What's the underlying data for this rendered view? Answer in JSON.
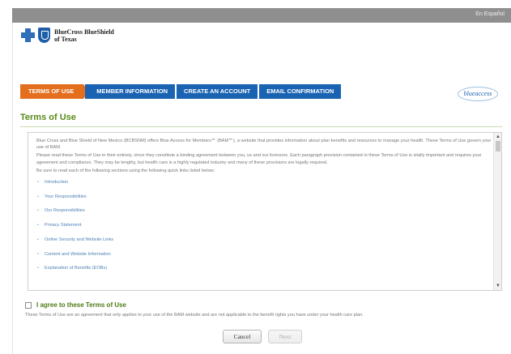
{
  "topbar": {
    "language_link": "En Español"
  },
  "logo": {
    "line1": "BlueCross BlueShield",
    "line2": "of Texas"
  },
  "steps": [
    {
      "label": "TERMS OF USE"
    },
    {
      "label": "MEMBER INFORMATION"
    },
    {
      "label": "CREATE AN ACCOUNT"
    },
    {
      "label": "EMAIL CONFIRMATION"
    }
  ],
  "blue_access_logo": "blueaccess",
  "page_title": "Terms of Use",
  "terms": {
    "paragraphs": [
      "Blue Cross and Blue Shield of New Mexico (BCBSNM) offers Blue Access for Members℠ (BAM℠), a website that provides information about plan benefits and resources to manage your health. These Terms of Use govern your use of BAM.",
      "Please read these Terms of Use in their entirety, since they constitute a binding agreement between you, us and our licensors. Each paragraph provision contained in these Terms of Use is vitally important and requires your agreement and compliance. They may be lengthy, but health care is a highly regulated industry and many of these provisions are legally required.",
      "Be sure to read each of the following sections using the following quick links listed below:"
    ],
    "links": [
      "Introduction",
      "Your Responsibilities",
      "Our Responsibilities",
      "Privacy Statement",
      "Online Security and Website Links",
      "Content and Website Information",
      "Explanation of Benefits (EOBs)"
    ]
  },
  "agree": {
    "label": "I agree to these Terms of Use"
  },
  "disclaimer": "These Terms of Use are an agreement that only applies to your use of the BAM website and are not applicable to the benefit rights you have under your health care plan.",
  "buttons": {
    "cancel": "Cancel",
    "next": "Next"
  }
}
